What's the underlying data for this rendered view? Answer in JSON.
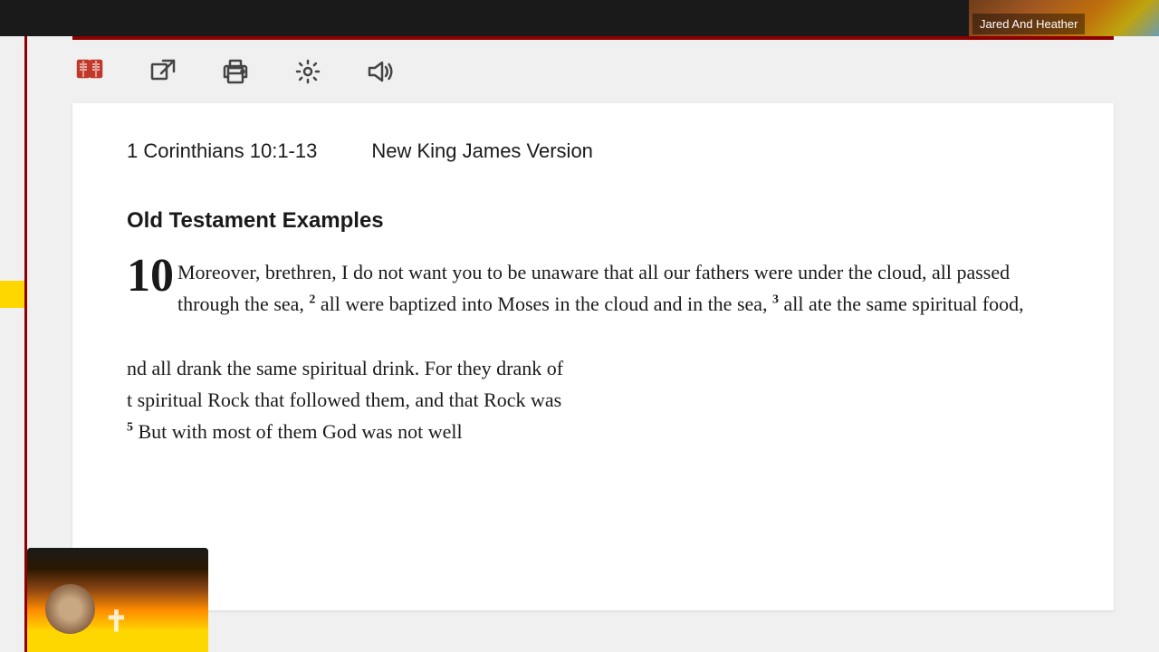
{
  "topbar": {
    "participant_name": "Jared And Heather"
  },
  "toolbar": {
    "icons": [
      {
        "name": "book-compare-icon",
        "label": "Compare Passages"
      },
      {
        "name": "external-link-icon",
        "label": "External Link"
      },
      {
        "name": "print-icon",
        "label": "Print"
      },
      {
        "name": "settings-icon",
        "label": "Settings"
      },
      {
        "name": "audio-icon",
        "label": "Audio"
      }
    ]
  },
  "document": {
    "passage_ref": "1 Corinthians 10:1-13",
    "version": "New King James Version",
    "section_title": "Old Testament Examples",
    "chapter_num": "10",
    "verse_text": "Moreover, brethren, I do not want you to be unaware that all our fathers were under the cloud, all passed through the sea,",
    "verse2_sup": "2",
    "verse2_text": " all were baptized into Moses in the cloud and in the sea,",
    "verse3_sup": "3",
    "verse3_text": " all ate the same spiritual food,",
    "verse4_text": "nd all drank the same spiritual drink. For they drank of",
    "verse4b_text": "t spiritual Rock that followed them, and that Rock was",
    "verse5_sup": "5",
    "verse5_text": " But with most of them God was not well"
  }
}
